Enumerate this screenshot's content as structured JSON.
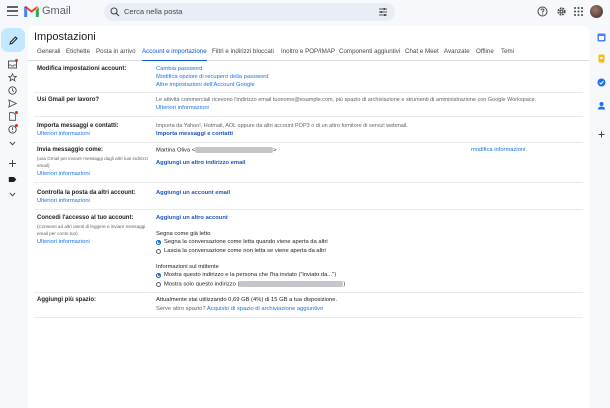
{
  "header": {
    "app_name": "Gmail",
    "search_placeholder": "Cerca nella posta"
  },
  "page": {
    "title": "Impostazioni"
  },
  "tabs": [
    {
      "label": "Generali"
    },
    {
      "label": "Etichette"
    },
    {
      "label": "Posta in arrivo"
    },
    {
      "label": "Account e importazione"
    },
    {
      "label": "Filtri e indirizzi bloccati"
    },
    {
      "label": "Inoltro e POP/IMAP"
    },
    {
      "label": "Componenti aggiuntivi"
    },
    {
      "label": "Chat e Meet"
    },
    {
      "label": "Avanzate"
    },
    {
      "label": "Offline"
    },
    {
      "label": "Temi"
    }
  ],
  "active_tab": "Account e importazione",
  "sections": {
    "modifica": {
      "title": "Modifica impostazioni account:",
      "links": [
        "Cambia password",
        "Modifica opzioni di recupero della password",
        "Altre impostazioni dell'Account Google"
      ]
    },
    "usi": {
      "title": "Usi Gmail per lavoro?",
      "text": "Le attività commerciali ricevono l'indirizzo email tuonome@example.com, più spazio di archiviazione e strumenti di amministrazione con Google Workspace.",
      "link": "Ulteriori informazioni"
    },
    "importa": {
      "title": "Importa messaggi e contatti:",
      "side_link": "Ulteriori informazioni",
      "text": "Importa da Yahoo!, Hotmail, AOL oppure da altri account POP3 o di un altro fornitore di servizi webmail.",
      "link": "Importa messaggi e contatti"
    },
    "invia": {
      "title": "Invia messaggio come:",
      "note": [
        "(usa Gmail per inviare messaggi dagli altri tuoi indirizzi",
        "email)"
      ],
      "side_link": "Ulteriori informazioni",
      "sender_name": "Martina Oliva <",
      "sender_close": ">",
      "edit_link": "modifica informazioni",
      "add_link": "Aggiungi un altro indirizzo email"
    },
    "controlla": {
      "title": "Controlla la posta da altri account:",
      "side_link": "Ulteriori informazioni",
      "link": "Aggiungi un account email"
    },
    "concedi": {
      "title": "Concedi l'accesso al tuo account:",
      "note": [
        "(Consenti ad altri utenti di leggere e inviare messaggi",
        "email per conto tuo)"
      ],
      "side_link": "Ulteriori informazioni",
      "add_link": "Aggiungi un altro account",
      "read_heading": "Segna come già letto",
      "read_options": [
        "Segna la conversazione come letta quando viene aperta da altri",
        "Lascia la conversazione come non letta se viene aperta da altri"
      ],
      "sender_heading": "Informazioni sul mittente",
      "sender_options": [
        "Mostra questo indirizzo e la persona che l'ha inviato (\"inviato da...\")",
        "Mostra solo questo indirizzo ("
      ],
      "sender_option_close": ")"
    },
    "spazio": {
      "title": "Aggiungi più spazio:",
      "text": "Attualmente stai utilizzando 0,69 GB (4%) di 15 GB a tua disposizione.",
      "prompt": "Serve altro spazio?",
      "link": "Acquisto di spazio di archiviazione aggiuntivo"
    }
  },
  "icons": {
    "rail": [
      "pencil-icon",
      "inbox-icon",
      "star-icon",
      "clock-icon",
      "send-icon",
      "file-icon",
      "info-icon",
      "chevron-icon",
      "plus-icon",
      "label-icon"
    ],
    "header": [
      "help-icon",
      "gear-icon",
      "apps-icon"
    ],
    "right_rail": [
      "calendar-icon",
      "keep-icon",
      "tasks-icon",
      "contacts-icon",
      "plus-icon"
    ]
  },
  "colors": {
    "accent": "#0b57d0",
    "link": "#1a73e8",
    "compose": "#c2e7ff",
    "background": "#f6f8fc"
  }
}
